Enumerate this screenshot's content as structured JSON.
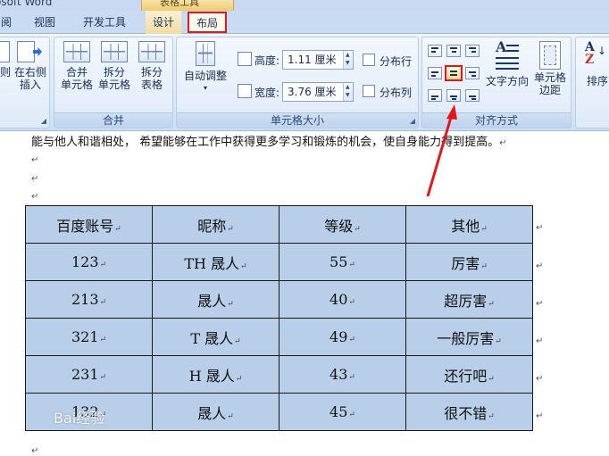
{
  "window": {
    "title_partial": "osoft Word"
  },
  "context_tab_header": "表格工具",
  "tabs": {
    "partial": "阅",
    "view": "视图",
    "developer": "开发工具",
    "design": "设计",
    "layout": "布局"
  },
  "ribbon": {
    "rows_columns": {
      "partial_label_1": "则",
      "insert_right_label_1": "在右侧",
      "insert_right_label_2": "插入"
    },
    "merge": {
      "title": "合并",
      "merge_cells_1": "合并",
      "merge_cells_2": "单元格",
      "split_cells_1": "拆分",
      "split_cells_2": "单元格",
      "split_table_1": "拆分",
      "split_table_2": "表格"
    },
    "cell_size": {
      "title": "单元格大小",
      "autofit": "自动调整",
      "height_label": "高度:",
      "height_value": "1.11 厘米",
      "width_label": "宽度:",
      "width_value": "3.76 厘米",
      "distribute_rows": "分布行",
      "distribute_cols": "分布列"
    },
    "alignment": {
      "title": "对齐方式",
      "text_direction": "文字方向",
      "cell_margins_1": "单元格",
      "cell_margins_2": "边距"
    },
    "data_partial": {
      "sort": "排序"
    }
  },
  "document": {
    "line1": "能与他人和谐相处，  希望能够在工作中获得更多学习和锻炼的机会，使自身能力得到提高。",
    "table": {
      "header": [
        "百度账号",
        "昵称",
        "等级",
        "其他"
      ],
      "rows": [
        [
          "123",
          "TH 晟人",
          "55",
          "厉害"
        ],
        [
          "213",
          "晟人",
          "40",
          "超厉害"
        ],
        [
          "321",
          "T 晟人",
          "49",
          "一般厉害"
        ],
        [
          "231",
          "H 晟人",
          "43",
          "还行吧"
        ],
        [
          "132",
          "晟人",
          "45",
          "很不错"
        ]
      ]
    }
  },
  "watermark": {
    "text": "Bai经验"
  },
  "colors": {
    "annotation_red": "#e3161b",
    "selection_blue": "#b9cfe9"
  }
}
